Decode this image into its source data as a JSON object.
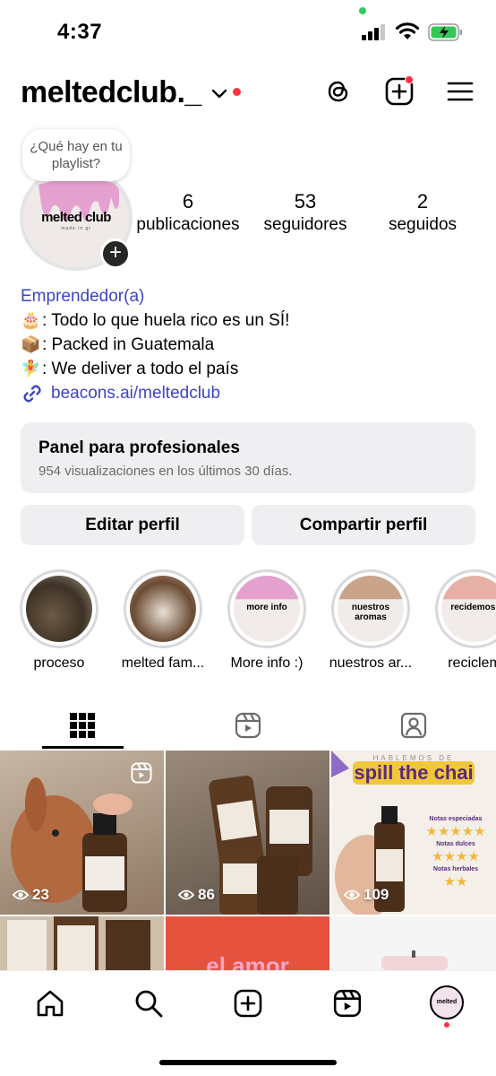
{
  "status_bar": {
    "time": "4:37"
  },
  "header": {
    "username": "meltedclub._"
  },
  "profile": {
    "bubble_text": "¿Qué hay en tu playlist?",
    "avatar_logo": "melted club",
    "avatar_sub": "made in gt",
    "stats": [
      {
        "value": "6",
        "label": "publicaciones"
      },
      {
        "value": "53",
        "label": "seguidores"
      },
      {
        "value": "2",
        "label": "seguidos"
      }
    ]
  },
  "bio": {
    "category": "Emprendedor(a)",
    "lines": [
      {
        "emoji": "🎂",
        "text": ": Todo lo que huela rico es un SÍ!"
      },
      {
        "emoji": "📦",
        "text": ": Packed in Guatemala"
      },
      {
        "emoji": "🧚",
        "text": ": We deliver a todo el país"
      }
    ],
    "link": "beacons.ai/meltedclub"
  },
  "panel": {
    "title": "Panel para profesionales",
    "subtitle": "954 visualizaciones en los últimos 30 días."
  },
  "buttons": {
    "edit": "Editar perfil",
    "share": "Compartir perfil"
  },
  "highlights": [
    {
      "label": "proceso",
      "cover_text": ""
    },
    {
      "label": "melted fam...",
      "cover_text": ""
    },
    {
      "label": "More info :)",
      "cover_text": "more info"
    },
    {
      "label": "nuestros ar...",
      "cover_text": "nuestros aromas"
    },
    {
      "label": "reciclem",
      "cover_text": "recidemos!"
    }
  ],
  "grid": {
    "posts": [
      {
        "views": "23"
      },
      {
        "views": "86"
      },
      {
        "views": "109"
      }
    ],
    "post3_title": "spill the chai",
    "post3_header": "HABLEMOS DE",
    "post3_notes": [
      "Notas especiadas",
      "Notas dulces",
      "Notas herbales"
    ],
    "post5_text": "el amor"
  },
  "colors": {
    "link_blue": "#3b45c4",
    "notif_red": "#ff3040",
    "panel_bg": "#efeff2",
    "brand_pink": "#e4a1d0"
  }
}
